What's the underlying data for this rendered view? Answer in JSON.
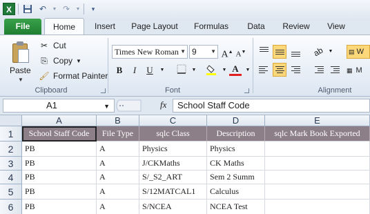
{
  "title_bar": {
    "app_icon_letter": "X",
    "icons": [
      "excel-logo-icon",
      "save-icon",
      "undo-icon",
      "redo-icon",
      "customize-qat-icon"
    ]
  },
  "tabs": {
    "file": "File",
    "items": [
      "Home",
      "Insert",
      "Page Layout",
      "Formulas",
      "Data",
      "Review",
      "View"
    ],
    "active": "Home"
  },
  "ribbon": {
    "clipboard": {
      "paste": "Paste",
      "cut": "Cut",
      "copy": "Copy",
      "format_painter": "Format Painter",
      "group_label": "Clipboard"
    },
    "font": {
      "font_name": "Times New Roman",
      "font_size": "9",
      "grow": "A",
      "shrink": "A",
      "bold": "B",
      "italic": "I",
      "underline": "U",
      "font_color_glyph": "A",
      "group_label": "Font"
    },
    "alignment": {
      "wrap_text": "W",
      "merge": "M",
      "group_label": "Alignment"
    }
  },
  "formula_bar": {
    "name_box": "A1",
    "fx": "fx",
    "content": "School Staff Code"
  },
  "sheet": {
    "columns": [
      "A",
      "B",
      "C",
      "D",
      "E"
    ],
    "row_numbers": [
      "1",
      "2",
      "3",
      "4",
      "5",
      "6"
    ],
    "header_row": [
      "School Staff Code",
      "File Type",
      "sqlc Class",
      "Description",
      "sqlc Mark Book Exported"
    ],
    "rows": [
      [
        "PB",
        "A",
        "Physics",
        "Physics",
        ""
      ],
      [
        "PB",
        "A",
        "J/CKMaths",
        "CK Maths",
        ""
      ],
      [
        "PB",
        "A",
        "S/_S2_ART",
        "Sem 2 Summ",
        ""
      ],
      [
        "PB",
        "A",
        "S/12MATCAL1",
        "Calculus",
        ""
      ],
      [
        "PB",
        "A",
        "S/NCEA",
        "NCEA Test",
        ""
      ]
    ],
    "header_fill": "#8d7f87",
    "selected_cell": "A1"
  }
}
